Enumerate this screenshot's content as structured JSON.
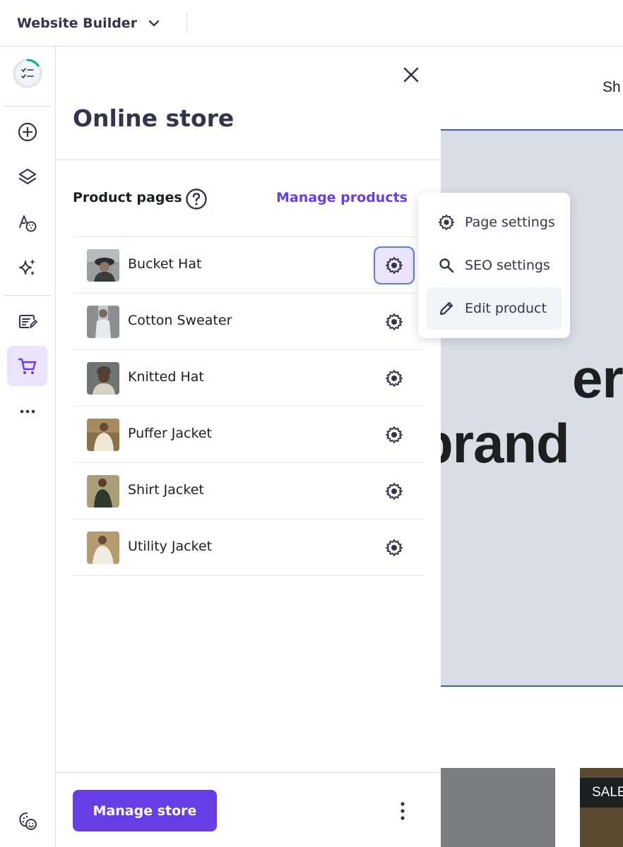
{
  "topbar": {
    "app_title": "Website Builder",
    "dropdown_icon": "chevron-down-icon"
  },
  "rail": {
    "items": [
      {
        "name": "checklist-progress",
        "icon": "checklist-icon"
      },
      {
        "name": "add-element",
        "icon": "plus-circle-icon"
      },
      {
        "name": "layers",
        "icon": "layers-icon"
      },
      {
        "name": "styles",
        "icon": "palette-icon"
      },
      {
        "name": "ai-tools",
        "icon": "sparkle-icon"
      },
      {
        "name": "blog",
        "icon": "edit-document-icon"
      },
      {
        "name": "online-store",
        "icon": "cart-icon",
        "active": true
      },
      {
        "name": "more",
        "icon": "more-horizontal-icon"
      },
      {
        "name": "cookie-consent",
        "icon": "cookie-icon"
      }
    ]
  },
  "panel": {
    "title": "Online store",
    "section_label": "Product pages",
    "manage_products_label": "Manage products",
    "products": [
      {
        "name": "Bucket Hat"
      },
      {
        "name": "Cotton Sweater"
      },
      {
        "name": "Knitted Hat"
      },
      {
        "name": "Puffer Jacket"
      },
      {
        "name": "Shirt Jacket"
      },
      {
        "name": "Utility Jacket"
      }
    ],
    "manage_store_label": "Manage store"
  },
  "menu": {
    "items": [
      {
        "label": "Page settings",
        "icon": "gear-icon"
      },
      {
        "label": "SEO settings",
        "icon": "search-icon"
      },
      {
        "label": "Edit product",
        "icon": "pencil-icon"
      }
    ]
  },
  "preview": {
    "nav_text": "Sh",
    "hero_line1": "er",
    "hero_line2": "brand",
    "sale_badge": "SALE"
  },
  "colors": {
    "accent": "#673de6",
    "accent_light": "#ebe4ff",
    "focus_ring": "#5b7ce6",
    "hero_bg": "#d8dde6",
    "text_dark": "#36344d"
  }
}
